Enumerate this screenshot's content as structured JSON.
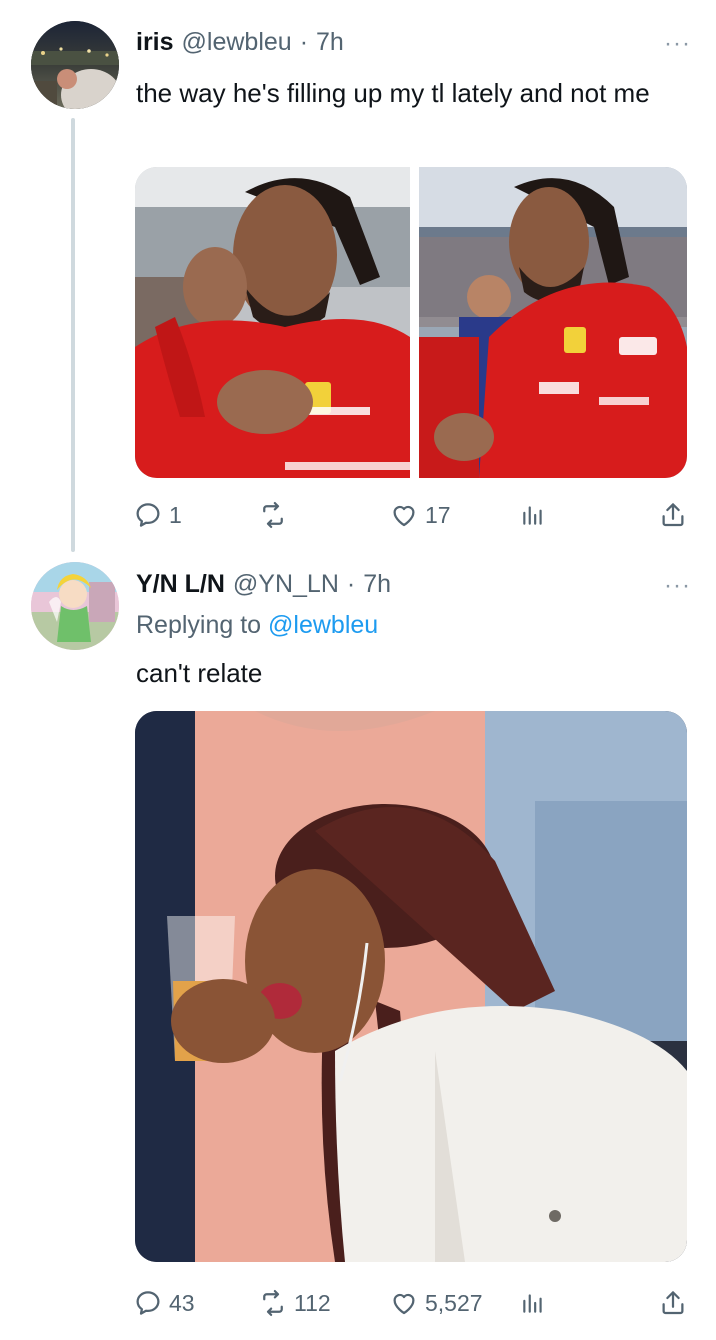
{
  "tweet": {
    "display_name": "iris",
    "handle": "@lewbleu",
    "separator": "·",
    "time": "7h",
    "text": "the way he's filling up my tl lately and not me",
    "more": "···",
    "actions": {
      "replies": "1",
      "retweets": "",
      "likes": "17"
    }
  },
  "reply": {
    "display_name": "Y/N L/N",
    "handle": "@YN_LN",
    "separator": "·",
    "time": "7h",
    "replying_prefix": "Replying to",
    "replying_to": "@lewbleu",
    "text": "can't relate",
    "more": "···",
    "actions": {
      "replies": "43",
      "retweets": "112",
      "likes": "5,527"
    }
  },
  "colors": {
    "text": "#0f1419",
    "muted": "#536471",
    "link": "#1d9bf0",
    "ferrari_red": "#d71c1c"
  },
  "icons": [
    "reply-icon",
    "retweet-icon",
    "like-icon",
    "analytics-icon",
    "share-icon"
  ]
}
